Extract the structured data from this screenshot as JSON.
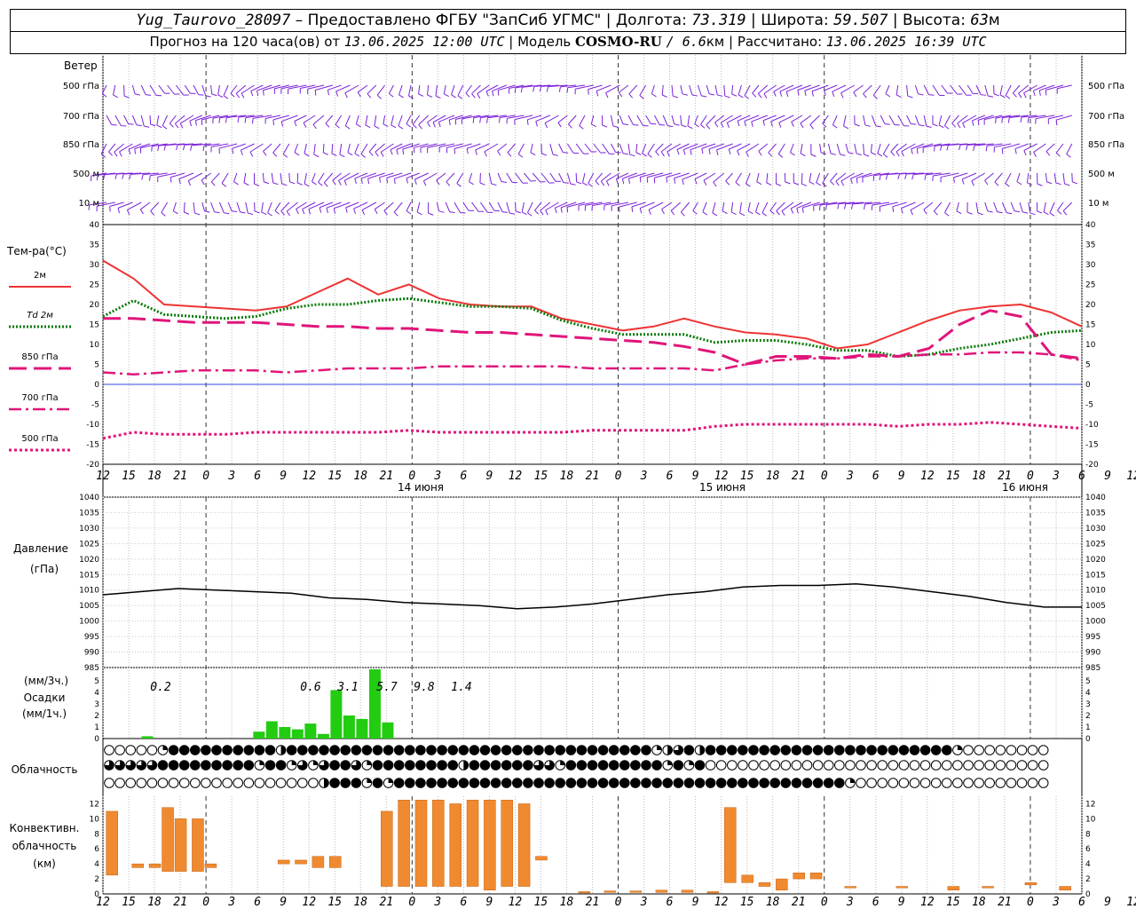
{
  "header": {
    "station": "Yug_Taurovo_28097",
    "provided": "– Предоставлено ФГБУ \"ЗапСиб УГМС\"",
    "lon_label": "Долгота:",
    "lon_value": "73.319",
    "lat_label": "Широта:",
    "lat_value": "59.507",
    "alt_label": "Высота:",
    "alt_value": "63",
    "alt_unit": "м",
    "forecast_prefix": "Прогноз на 120 часа(ов) от",
    "forecast_time": "13.06.2025 12:00 UTC",
    "model_prefix": "Модель",
    "model_name": "COSMO-RU",
    "model_res": "/ 6.6",
    "model_res_unit": "км",
    "calc_label": "Рассчитано:",
    "calc_time": "13.06.2025 16:39 UTC"
  },
  "labels": {
    "wind": "Ветер",
    "wind_levels": [
      "500 гПа",
      "700 гПа",
      "850 гПа",
      "500 м",
      "10  м"
    ],
    "temp_title": "Тем-ра(°С)",
    "temp_legend": [
      "2м",
      "Td  2м",
      "850 гПа",
      "700 гПа",
      "500 гПа"
    ],
    "pressure_title": "Давление",
    "pressure_unit": "(гПа)",
    "precip_unit3": "(мм/3ч.)",
    "precip_title": "Осадки",
    "precip_unit1": "(мм/1ч.)",
    "cloud_title": "Облачность",
    "conv_title": "Конвективн.",
    "conv_title2": "облачность",
    "conv_unit": "(км)"
  },
  "colors": {
    "wind": "#7b22d8",
    "t2m": "#ee3333",
    "td2m": "#0a7a0a",
    "t850": "#e0157a",
    "t700": "#e0157a",
    "t500": "#e0157a",
    "precip": "#22cc11",
    "conv": "#f08a30",
    "zero_line": "#3344dd"
  },
  "chart_data": [
    {
      "type": "line",
      "title": "Тем-ра(°С)",
      "ylim": [
        -20,
        40
      ],
      "yticks": [
        -20,
        -15,
        -10,
        -5,
        0,
        5,
        10,
        15,
        20,
        25,
        30,
        35,
        40
      ],
      "x_hours_from_start": [
        0,
        3,
        6,
        9,
        12,
        15,
        18,
        21,
        24,
        27,
        30,
        33,
        36,
        39,
        42,
        45,
        48,
        51,
        54,
        57,
        60,
        63,
        66,
        69,
        72,
        75,
        78,
        81,
        84,
        87,
        90,
        93,
        96,
        99,
        102,
        105,
        108,
        111,
        114
      ],
      "x_tick_labels": [
        "12",
        "15",
        "18",
        "21",
        "0",
        "3",
        "6",
        "9",
        "12",
        "15",
        "18",
        "21",
        "0",
        "3",
        "6",
        "9",
        "12",
        "15",
        "18",
        "21",
        "0",
        "3",
        "6",
        "9",
        "12",
        "15",
        "18",
        "21",
        "0",
        "3",
        "6",
        "9",
        "12",
        "15",
        "18",
        "21",
        "0",
        "3",
        "6",
        "9",
        "12",
        "15",
        "18"
      ],
      "day_labels": [
        "14 июня",
        "15 июня",
        "16 июня"
      ],
      "series": [
        {
          "name": "2м",
          "values": [
            31,
            26.5,
            20,
            19.5,
            19,
            18.5,
            19.5,
            23,
            26.5,
            22.5,
            25,
            21.5,
            20,
            19.5,
            19.5,
            16.5,
            15,
            13.5,
            14.5,
            16.5,
            14.5,
            13,
            12.5,
            11.5,
            9,
            10,
            13,
            16,
            18.5,
            19.5,
            20,
            18,
            14.5
          ]
        },
        {
          "name": "Td  2м",
          "values": [
            17,
            21,
            17.5,
            17,
            16.5,
            17,
            19,
            20,
            20,
            21,
            21.5,
            20.5,
            19.5,
            19.5,
            19,
            16,
            14,
            12.5,
            12.5,
            12.5,
            10.5,
            11,
            11,
            10,
            8.5,
            8.5,
            7,
            7.5,
            9,
            10,
            11.5,
            13,
            13.5
          ]
        },
        {
          "name": "850 гПа",
          "values": [
            16.5,
            16.5,
            16,
            15.5,
            15.5,
            15.5,
            15,
            14.5,
            14.5,
            14,
            14,
            13.5,
            13,
            13,
            12.5,
            12,
            11.5,
            11,
            10.5,
            9.5,
            8,
            5,
            7,
            7,
            6.5,
            7.5,
            7,
            9,
            15,
            18.5,
            17,
            7.5,
            6.5
          ]
        },
        {
          "name": "700 гПа",
          "values": [
            3,
            2.5,
            3,
            3.5,
            3.5,
            3.5,
            3,
            3.5,
            4,
            4,
            4,
            4.5,
            4.5,
            4.5,
            4.5,
            4.5,
            4,
            4,
            4,
            4,
            3.5,
            5,
            6,
            6.5,
            6.5,
            7,
            7,
            7.5,
            7.5,
            8,
            8,
            7.5,
            6
          ]
        },
        {
          "name": "500 гПа",
          "values": [
            -13.5,
            -12,
            -12.5,
            -12.5,
            -12.5,
            -12,
            -12,
            -12,
            -12,
            -12,
            -11.5,
            -12,
            -12,
            -12,
            -12,
            -12,
            -11.5,
            -11.5,
            -11.5,
            -11.5,
            -10.5,
            -10,
            -10,
            -10,
            -10,
            -10,
            -10.5,
            -10,
            -10,
            -9.5,
            -10,
            -10.5,
            -11
          ]
        }
      ]
    },
    {
      "type": "line",
      "title": "Давление",
      "ylim": [
        985,
        1040
      ],
      "yticks": [
        985,
        990,
        995,
        1000,
        1005,
        1010,
        1015,
        1020,
        1025,
        1030,
        1035,
        1040
      ],
      "series": [
        {
          "name": "Давление",
          "values": [
            1008.5,
            1009.5,
            1010.5,
            1010,
            1009.5,
            1009,
            1007.5,
            1007,
            1006,
            1005.5,
            1005,
            1004,
            1004.5,
            1005.5,
            1007,
            1008.5,
            1009.5,
            1011,
            1011.5,
            1011.5,
            1012,
            1011,
            1009.5,
            1008,
            1006,
            1004.5,
            1004.5
          ]
        }
      ]
    },
    {
      "type": "bar",
      "title": "Осадки",
      "ylim": [
        0,
        6
      ],
      "yticks": [
        0,
        1,
        2,
        3,
        4,
        5
      ],
      "three_hour_totals": [
        "0.2",
        "0.6",
        "3.1",
        "5.7",
        "9.8",
        "1.4"
      ],
      "hourly_values": [
        0.2,
        0.6,
        1.5,
        1,
        0.8,
        1.3,
        0.4,
        4.2,
        2,
        1.7,
        6,
        1.4
      ]
    },
    {
      "type": "bar",
      "title": "Конвективн. облачность",
      "ylim": [
        0,
        13
      ],
      "yticks": [
        0,
        2,
        4,
        6,
        8,
        10,
        12
      ],
      "segments": [
        [
          2.5,
          11
        ],
        [
          3.5,
          4
        ],
        [
          3.5,
          4
        ],
        [
          3,
          11.5
        ],
        [
          3,
          10
        ],
        [
          3,
          10
        ],
        [
          3.5,
          4
        ],
        [
          4,
          4.5
        ],
        [
          4,
          4.5
        ],
        [
          3.5,
          5
        ],
        [
          3.5,
          5
        ],
        [
          1,
          11
        ],
        [
          1,
          12.5
        ],
        [
          1,
          12.5
        ],
        [
          1,
          12.5
        ],
        [
          1,
          12
        ],
        [
          1,
          12.5
        ],
        [
          0.5,
          12.5
        ],
        [
          1,
          12.5
        ],
        [
          1,
          12
        ],
        [
          4.5,
          5
        ],
        [
          0.2,
          0.3
        ],
        [
          0.2,
          0.4
        ],
        [
          0.2,
          0.4
        ],
        [
          0.2,
          0.5
        ],
        [
          0.2,
          0.5
        ],
        [
          0.2,
          0.3
        ],
        [
          1.5,
          11.5
        ],
        [
          1.5,
          2.5
        ],
        [
          1,
          1.5
        ],
        [
          0.5,
          2
        ],
        [
          2,
          2.8
        ],
        [
          2,
          2.8
        ],
        [
          0.8,
          1
        ],
        [
          0.8,
          1
        ],
        [
          0.5,
          1
        ],
        [
          0.8,
          1
        ],
        [
          1.2,
          1.5
        ],
        [
          0.5,
          1
        ]
      ]
    }
  ],
  "cloud_rows": {
    "row1": "oooooqFFFFFFFFFFHFFFFFFFFFFFFFFFFFFFFFFFFFFFFFFFFFFqHQFHFFFFFFFFFFFFFFFFFFFFFFFqoooooooooooooooooooooooooooooooooooooooq",
    "row2": "QQQQQFFFFFFFFFqFFqQqQFFQqFFFFFFFFHFFFFFFQQqFFFFFFFFFqFqFoooooooooooooooooooooooooooooooooooooooooooooooooq",
    "row3": "ooooooooooooooooooooHFFFqFqFFFFFFFFFFFFFFFFFFFFFFFFFFFFFFFFFFFFFFFFFFqoooooooooooooooooooooooooooooooooooo"
  }
}
